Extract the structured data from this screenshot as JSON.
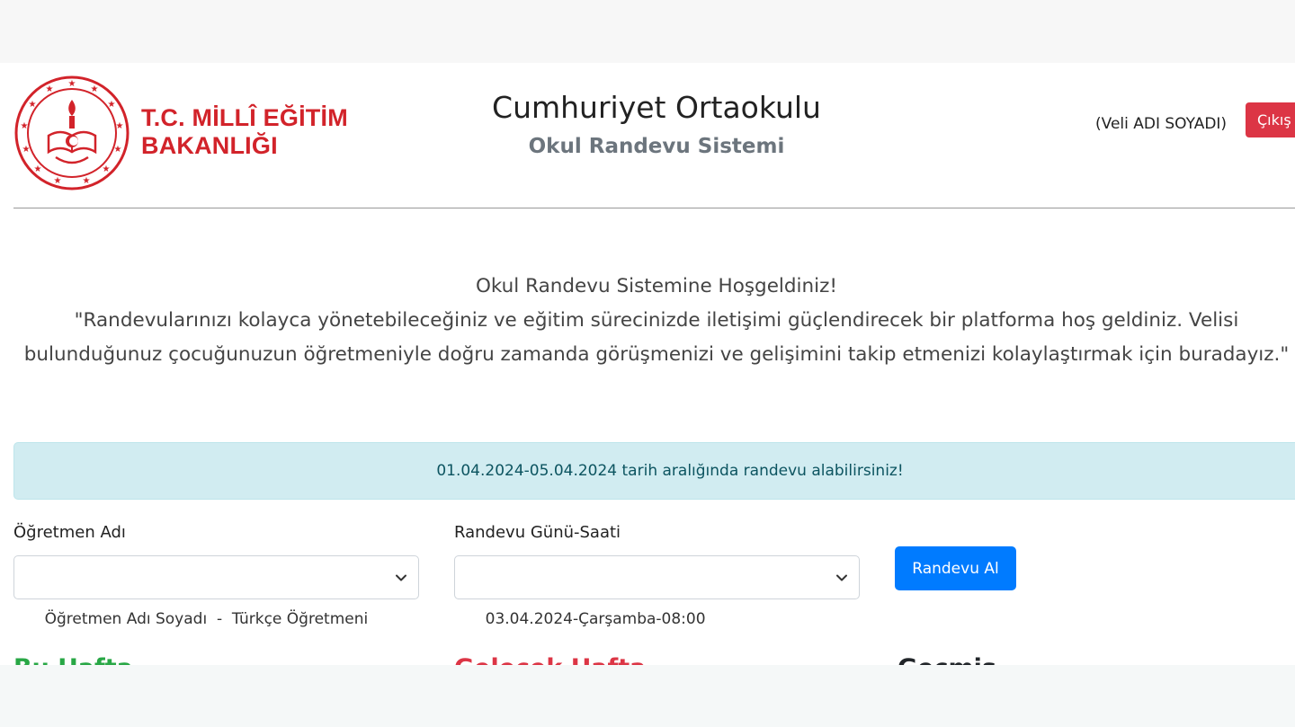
{
  "header": {
    "logo_text_line1": "T.C. MİLLÎ EĞİTİM",
    "logo_text_line2": "BAKANLIĞI",
    "school_name": "Cumhuriyet Ortaokulu",
    "system_name": "Okul Randevu Sistemi",
    "user_name": "(Veli ADI SOYADI)",
    "logout_label": "Çıkış"
  },
  "welcome": {
    "title": "Okul Randevu Sistemine Hoşgeldiniz!",
    "line1": "\"Randevularınızı kolayca yönetebileceğiniz ve eğitim sürecinizde iletişimi güçlendirecek bir platforma hoş geldiniz. Velisi",
    "line2": "bulunduğunuz çocuğunuzun öğretmeniyle doğru zamanda görüşmenizi ve gelişimini takip etmenizi kolaylaştırmak için buradayız.\""
  },
  "alert": {
    "text": "01.04.2024-05.04.2024 tarih aralığında randevu alabilirsiniz!"
  },
  "form": {
    "teacher_label": "Öğretmen Adı",
    "teacher_value": "Öğretmen Adı Soyadı  -  Türkçe Öğretmeni",
    "datetime_label": "Randevu Günü-Saati",
    "datetime_value": "03.04.2024-Çarşamba-08:00",
    "submit_label": "Randevu Al"
  },
  "sections": {
    "this_week": "Bu Hafta",
    "next_week": "Gelecek Hafta",
    "past": "Geçmiş"
  },
  "colors": {
    "brand_red": "#d2232a",
    "danger": "#dc3545",
    "primary": "#007bff",
    "alert_bg": "#d1ecf1",
    "alert_text": "#0c5460",
    "this_week": "#28a745",
    "next_week": "#dc3545",
    "past": "#212529"
  }
}
